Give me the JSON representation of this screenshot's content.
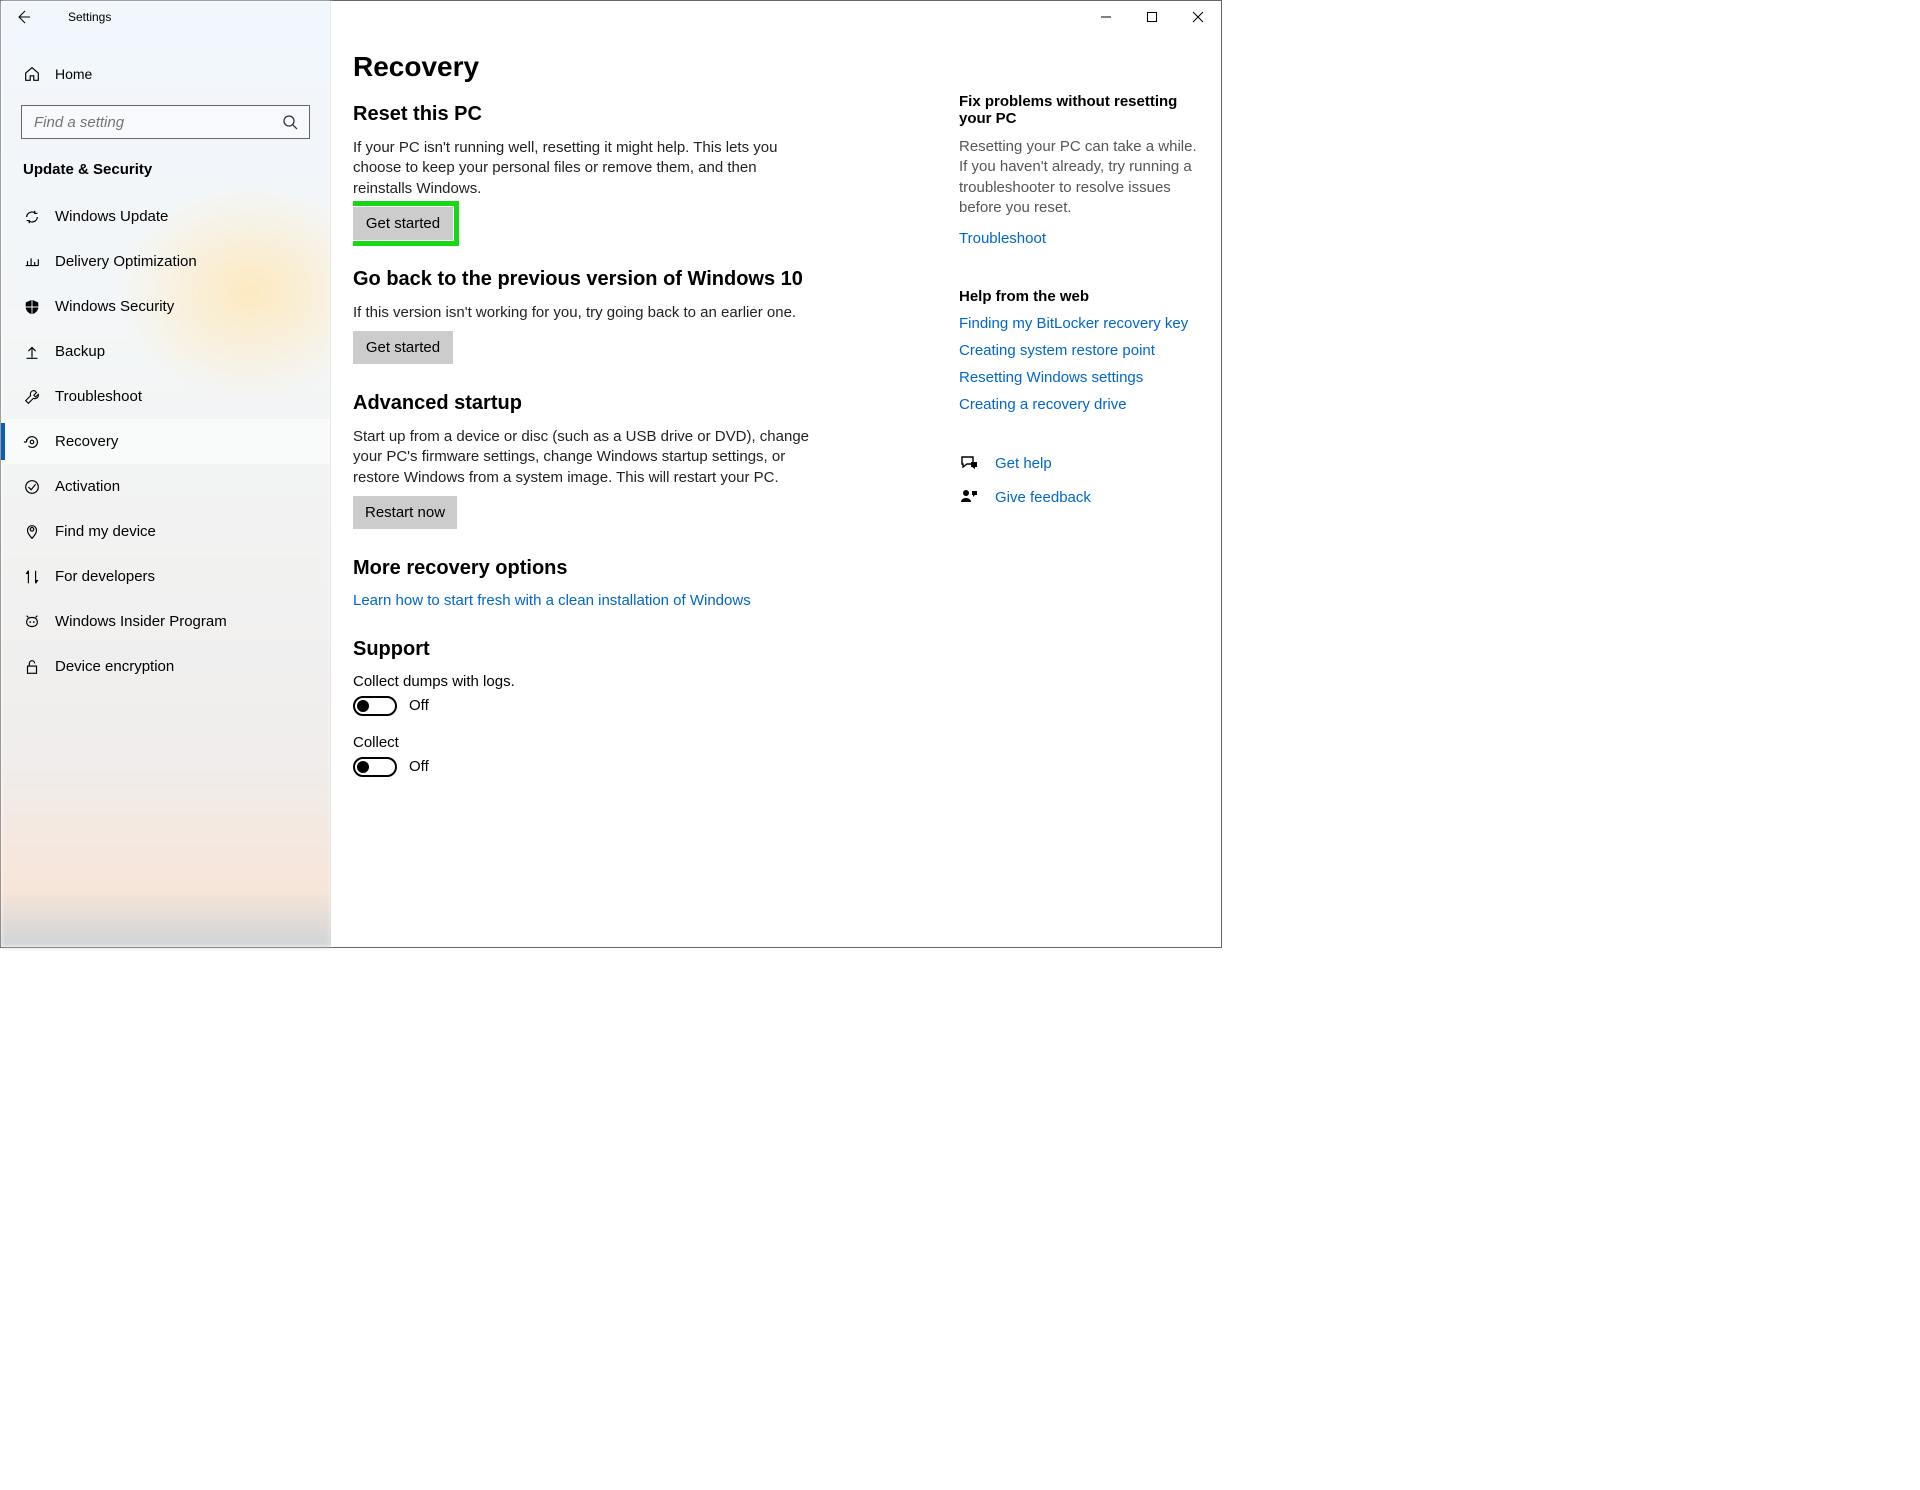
{
  "window": {
    "title": "Settings"
  },
  "sidebar": {
    "home": "Home",
    "search_placeholder": "Find a setting",
    "section": "Update & Security",
    "items": [
      {
        "label": "Windows Update"
      },
      {
        "label": "Delivery Optimization"
      },
      {
        "label": "Windows Security"
      },
      {
        "label": "Backup"
      },
      {
        "label": "Troubleshoot"
      },
      {
        "label": "Recovery"
      },
      {
        "label": "Activation"
      },
      {
        "label": "Find my device"
      },
      {
        "label": "For developers"
      },
      {
        "label": "Windows Insider Program"
      },
      {
        "label": "Device encryption"
      }
    ]
  },
  "page": {
    "title": "Recovery",
    "reset": {
      "heading": "Reset this PC",
      "body": "If your PC isn't running well, resetting it might help. This lets you choose to keep your personal files or remove them, and then reinstalls Windows.",
      "button": "Get started"
    },
    "goback": {
      "heading": "Go back to the previous version of Windows 10",
      "body": "If this version isn't working for you, try going back to an earlier one.",
      "button": "Get started"
    },
    "advanced": {
      "heading": "Advanced startup",
      "body": "Start up from a device or disc (such as a USB drive or DVD), change your PC's firmware settings, change Windows startup settings, or restore Windows from a system image. This will restart your PC.",
      "button": "Restart now"
    },
    "more": {
      "heading": "More recovery options",
      "link": "Learn how to start fresh with a clean installation of Windows"
    },
    "support": {
      "heading": "Support",
      "dumps_label": "Collect dumps with logs.",
      "dumps_state": "Off",
      "collect_label": "Collect",
      "collect_state": "Off"
    }
  },
  "right": {
    "fix": {
      "heading": "Fix problems without resetting your PC",
      "body": "Resetting your PC can take a while. If you haven't already, try running a troubleshooter to resolve issues before you reset.",
      "link": "Troubleshoot"
    },
    "help": {
      "heading": "Help from the web",
      "links": [
        "Finding my BitLocker recovery key",
        "Creating system restore point",
        "Resetting Windows settings",
        "Creating a recovery drive"
      ]
    },
    "get_help": "Get help",
    "give_feedback": "Give feedback"
  }
}
